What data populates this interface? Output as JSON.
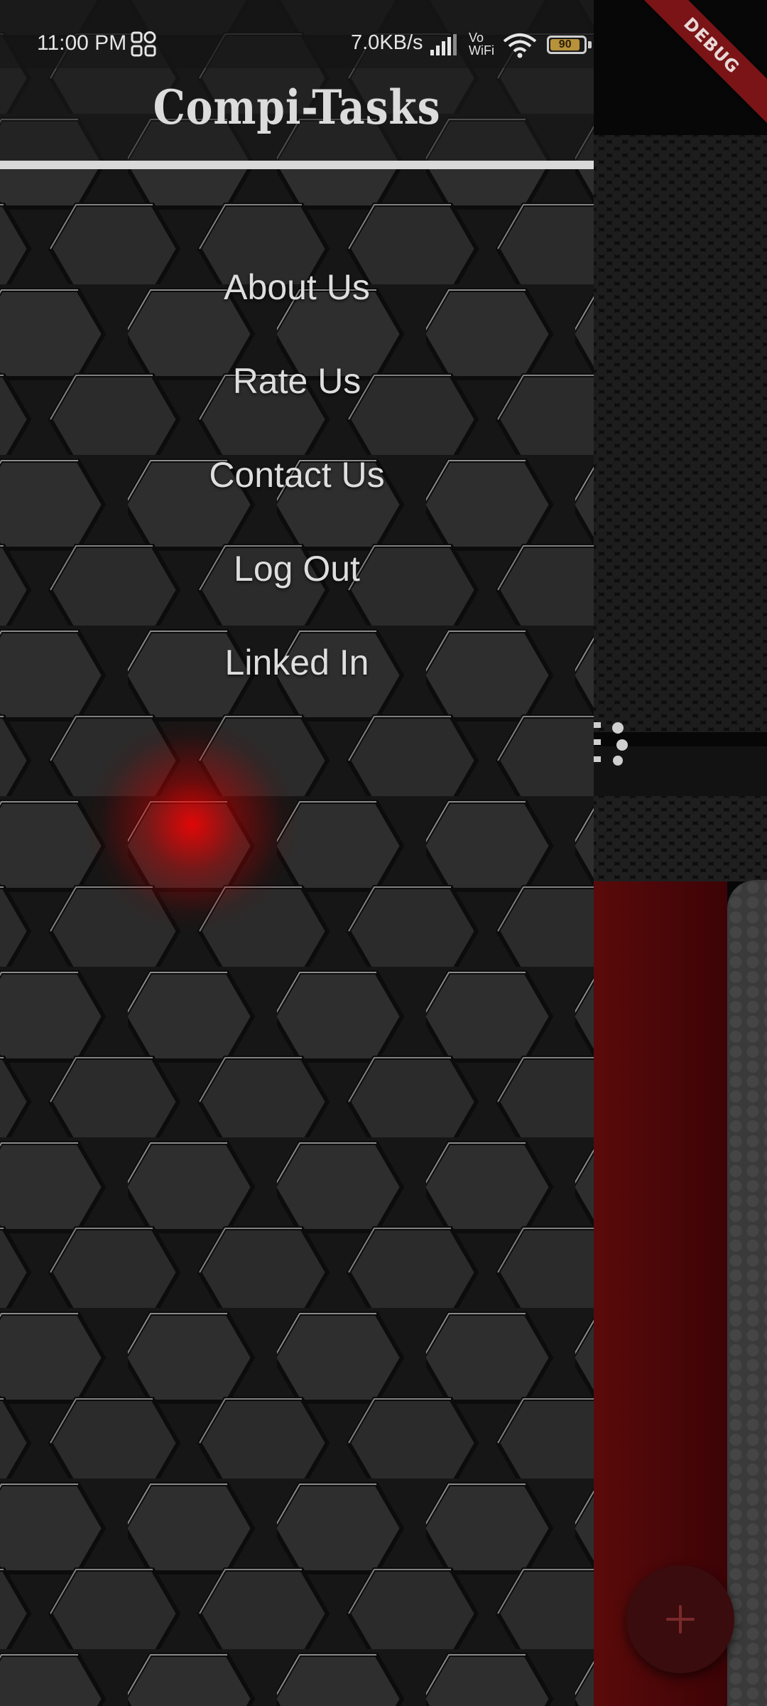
{
  "status_bar": {
    "time": "11:00 PM",
    "network_speed": "7.0KB/s",
    "vowifi_top": "Vo",
    "vowifi_bottom": "WiFi",
    "battery_level": 90,
    "battery_label": "90"
  },
  "debug_banner": {
    "label": "DEBUG"
  },
  "drawer": {
    "title": "Compi-Tasks",
    "menu": [
      {
        "label": "About Us"
      },
      {
        "label": "Rate Us"
      },
      {
        "label": "Contact Us"
      },
      {
        "label": "Log Out"
      },
      {
        "label": "Linked In"
      }
    ]
  },
  "fab": {
    "icon": "plus-icon"
  },
  "colors": {
    "accent_red": "#7a1416",
    "drawer_text": "#dedede",
    "fab_background": "#3b0c0d"
  }
}
